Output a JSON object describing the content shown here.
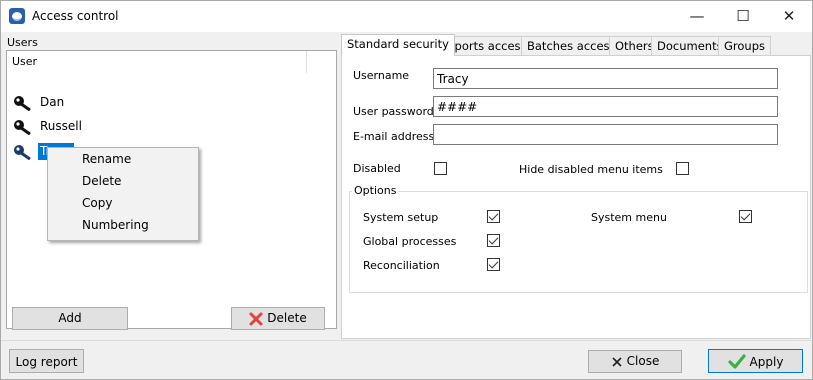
{
  "window": {
    "title": "Access control",
    "icon": "app-icon",
    "controls": {
      "minimize": "—",
      "maximize": "☐",
      "close": "✕"
    }
  },
  "users_panel": {
    "group_label": "Users",
    "column_header": "User",
    "users": [
      {
        "name": "Dan",
        "icon": "key-icon",
        "selected": false
      },
      {
        "name": "Russell",
        "icon": "key-icon",
        "selected": false
      },
      {
        "name": "Tracy",
        "icon": "key-icon",
        "selected": true
      }
    ],
    "context_menu": {
      "items": [
        "Rename",
        "Delete",
        "Copy",
        "Numbering"
      ]
    },
    "add_label": "Add",
    "delete_label": "Delete"
  },
  "tabs": [
    "Standard security",
    "Reports access",
    "Batches access",
    "Others",
    "Documents",
    "Groups"
  ],
  "active_tab": "Standard security",
  "form": {
    "username_label": "Username",
    "username_value": "Tracy",
    "password_label": "User password",
    "password_value": "####",
    "email_label": "E-mail address",
    "email_value": "",
    "disabled_label": "Disabled",
    "disabled_checked": false,
    "hide_disabled_label": "Hide disabled menu items",
    "hide_disabled_checked": false,
    "options_legend": "Options",
    "options": {
      "system_setup": {
        "label": "System setup",
        "checked": true
      },
      "global_processes": {
        "label": "Global processes",
        "checked": true
      },
      "reconciliation": {
        "label": "Reconciliation",
        "checked": true
      },
      "system_menu": {
        "label": "System menu",
        "checked": true
      }
    }
  },
  "footer": {
    "log_report_label": "Log report",
    "close_label": "Close",
    "apply_label": "Apply"
  },
  "colors": {
    "selection": "#0078d7",
    "delete_icon": "#e04343",
    "apply_icon": "#3cb043"
  }
}
